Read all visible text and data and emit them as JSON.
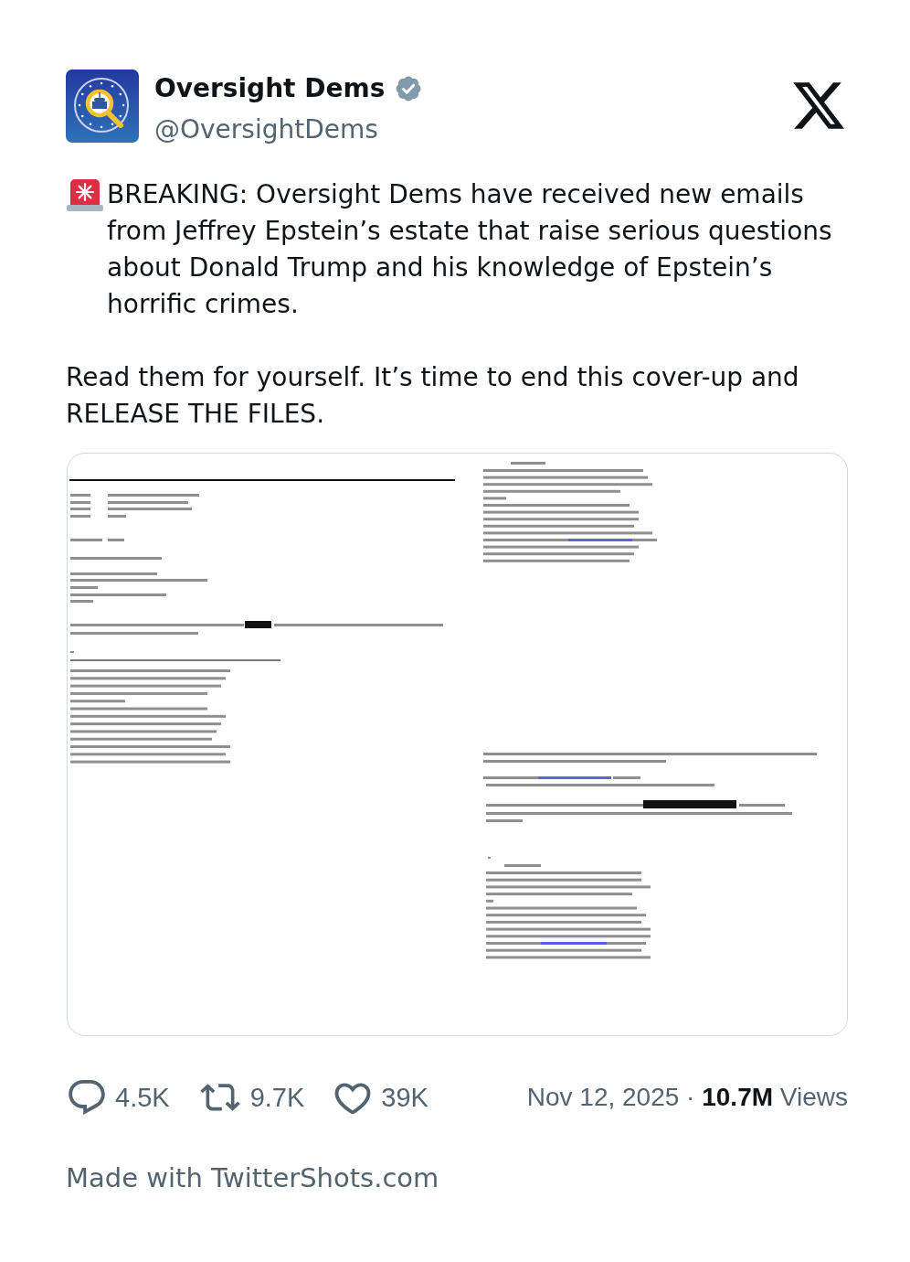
{
  "author": {
    "name": "Oversight Dems",
    "handle": "@OversightDems",
    "verified": true
  },
  "post": {
    "paragraphs": [
      "BREAKING: Oversight Dems have received new emails from Jeffrey Epstein’s estate that raise serious questions about Donald Trump and his knowledge of Epstein’s horrific crimes.",
      "Read them for yourself. It’s time to end this cover-up and RELEASE THE FILES."
    ]
  },
  "actions": [
    {
      "kind": "reply",
      "count": "4.5K"
    },
    {
      "kind": "repost",
      "count": "9.7K"
    },
    {
      "kind": "like",
      "count": "39K"
    }
  ],
  "meta": "Nov 12, 2025 · **10.7M** Views",
  "footer": "Made with TwitterShots.com"
}
